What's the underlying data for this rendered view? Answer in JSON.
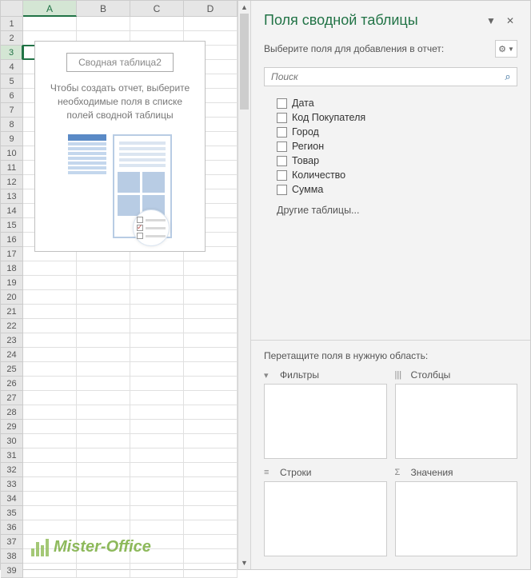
{
  "grid": {
    "columns": [
      "A",
      "B",
      "C",
      "D"
    ],
    "row_count": 39,
    "active_cell": "A3",
    "active_col": "A",
    "active_row": 3
  },
  "pivot_placeholder": {
    "title": "Сводная таблица2",
    "message": "Чтобы создать отчет, выберите необходимые поля в списке полей сводной таблицы"
  },
  "panel": {
    "title": "Поля сводной таблицы",
    "subtitle": "Выберите поля для добавления в отчет:",
    "search_placeholder": "Поиск",
    "other_tables": "Другие таблицы...",
    "drop_hint": "Перетащите поля в нужную область:"
  },
  "fields": [
    {
      "label": "Дата",
      "checked": false
    },
    {
      "label": "Код Покупателя",
      "checked": false
    },
    {
      "label": "Город",
      "checked": false
    },
    {
      "label": "Регион",
      "checked": false
    },
    {
      "label": "Товар",
      "checked": false
    },
    {
      "label": "Количество",
      "checked": false
    },
    {
      "label": "Сумма",
      "checked": false
    }
  ],
  "drop_zones": {
    "filters": "Фильтры",
    "columns": "Столбцы",
    "rows": "Строки",
    "values": "Значения"
  },
  "icons": {
    "dropdown": "▼",
    "close": "✕",
    "gear": "⚙",
    "search": "🔍",
    "filter": "▼",
    "columns": "|||",
    "rows": "≡",
    "sigma": "Σ"
  },
  "watermark": "Mister-Office"
}
